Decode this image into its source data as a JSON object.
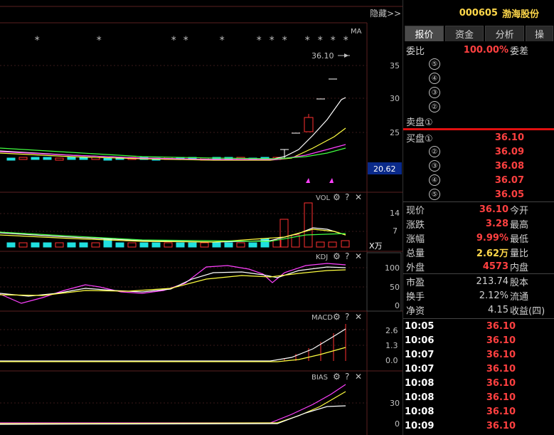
{
  "chart": {
    "hide_label": "隐藏>>",
    "ma_label": "MA",
    "price_label": "36.10",
    "current_price_box": "20.62",
    "price_ticks": [
      "35",
      "30",
      "25"
    ],
    "vol_label": "VOL",
    "vol_ticks": [
      "14",
      "7"
    ],
    "vol_unit": "X万",
    "kdj_label": "KDJ",
    "kdj_ticks": [
      "100",
      "50",
      "0"
    ],
    "macd_label": "MACD",
    "macd_ticks": [
      "2.6",
      "1.3",
      "0.0"
    ],
    "bias_label": "BIAS",
    "bias_ticks": [
      "30",
      "0"
    ]
  },
  "stock": {
    "code": "000605",
    "name": "渤海股份"
  },
  "tabs": [
    "报价",
    "资金",
    "分析",
    "操"
  ],
  "weibi": {
    "label": "委比",
    "value": "100.00%",
    "label2": "委差"
  },
  "sell_orders": [
    {
      "level": "⑤",
      "price": "",
      "vol": ""
    },
    {
      "level": "④",
      "price": "",
      "vol": ""
    },
    {
      "level": "③",
      "price": "",
      "vol": ""
    },
    {
      "level": "②",
      "price": "",
      "vol": ""
    },
    {
      "level": "卖盘①",
      "price": "",
      "vol": ""
    }
  ],
  "buy_orders": [
    {
      "level": "买盘①",
      "price": "36.10"
    },
    {
      "level": "②",
      "price": "36.09"
    },
    {
      "level": "③",
      "price": "36.08"
    },
    {
      "level": "④",
      "price": "36.07"
    },
    {
      "level": "⑤",
      "price": "36.05"
    }
  ],
  "quote": [
    {
      "l1": "现价",
      "v1": "36.10",
      "l2": "今开",
      "c1": "red"
    },
    {
      "l1": "涨跌",
      "v1": "3.28",
      "l2": "最高",
      "c1": "red"
    },
    {
      "l1": "涨幅",
      "v1": "9.99%",
      "l2": "最低",
      "c1": "red"
    },
    {
      "l1": "总量",
      "v1": "2.62万",
      "l2": "量比",
      "c1": "yellow"
    },
    {
      "l1": "外盘",
      "v1": "4573",
      "l2": "内盘",
      "c1": "red"
    }
  ],
  "info": [
    {
      "l1": "市盈",
      "v1": "213.74",
      "l2": "股本"
    },
    {
      "l1": "换手",
      "v1": "2.12%",
      "l2": "流通"
    },
    {
      "l1": "净资",
      "v1": "4.15",
      "l2": "收益(四)"
    }
  ],
  "ticks": [
    {
      "time": "10:05",
      "price": "36.10"
    },
    {
      "time": "10:06",
      "price": "36.10"
    },
    {
      "time": "10:07",
      "price": "36.10"
    },
    {
      "time": "10:07",
      "price": "36.10"
    },
    {
      "time": "10:08",
      "price": "36.10"
    },
    {
      "time": "10:08",
      "price": "36.10"
    },
    {
      "time": "10:08",
      "price": "36.10"
    },
    {
      "time": "10:09",
      "price": "36.10"
    }
  ]
}
